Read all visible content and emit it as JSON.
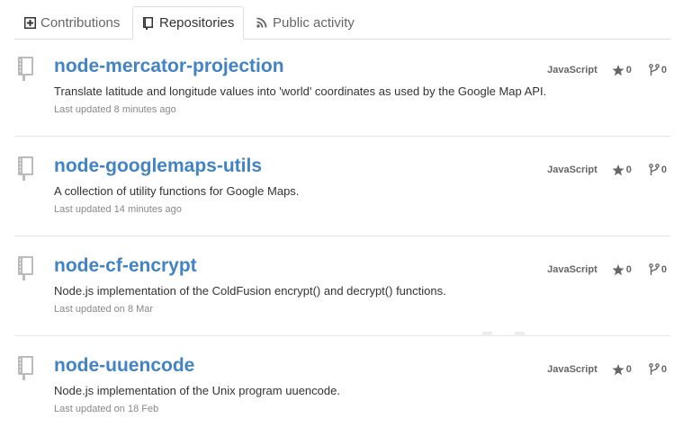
{
  "tabs": [
    {
      "label": "Contributions",
      "icon": "plus-box-icon",
      "selected": false
    },
    {
      "label": "Repositories",
      "icon": "book-icon",
      "selected": true
    },
    {
      "label": "Public activity",
      "icon": "rss-icon",
      "selected": false
    }
  ],
  "repos": [
    {
      "name": "node-mercator-projection",
      "description": "Translate latitude and longitude values into 'world' coordinates as used by the Google Map API.",
      "updated": "Last updated 8 minutes ago",
      "language": "JavaScript",
      "stars": "0",
      "forks": "0"
    },
    {
      "name": "node-googlemaps-utils",
      "description": "A collection of utility functions for Google Maps.",
      "updated": "Last updated 14 minutes ago",
      "language": "JavaScript",
      "stars": "0",
      "forks": "0"
    },
    {
      "name": "node-cf-encrypt",
      "description": "Node.js implementation of the ColdFusion encrypt() and decrypt() functions.",
      "updated": "Last updated on 8 Mar",
      "language": "JavaScript",
      "stars": "0",
      "forks": "0"
    },
    {
      "name": "node-uuencode",
      "description": "Node.js implementation of the Unix program uuencode.",
      "updated": "Last updated on 18 Feb",
      "language": "JavaScript",
      "stars": "0",
      "forks": "0"
    }
  ],
  "colors": {
    "link": "#4183c4",
    "muted": "#888888",
    "icon": "#bbbbbb",
    "border": "#dddddd"
  },
  "icons": {
    "repo": "repo-book-icon",
    "star": "star-icon",
    "fork": "fork-icon"
  }
}
